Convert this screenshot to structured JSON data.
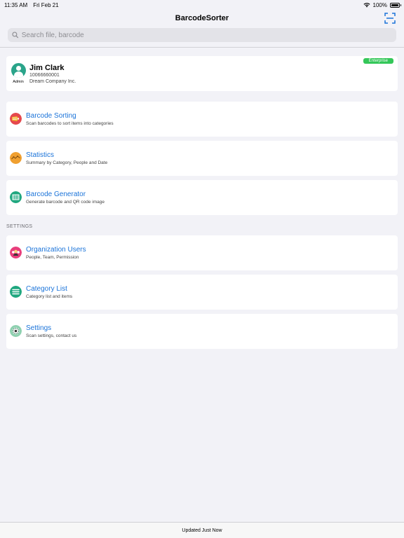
{
  "status_bar": {
    "time": "11:35 AM",
    "date": "Fri Feb 21",
    "battery": "100%"
  },
  "nav": {
    "title": "BarcodeSorter"
  },
  "search": {
    "placeholder": "Search file, barcode"
  },
  "profile": {
    "name": "Jim Clark",
    "id": "10066660001",
    "company": "Dream Company Inc.",
    "role": "Admin",
    "badge": "Enterprise"
  },
  "menu": [
    {
      "title": "Barcode Sorting",
      "subtitle": "Scan barcodes to sort items into categories"
    },
    {
      "title": "Statistics",
      "subtitle": "Summary by Category, People and Date"
    },
    {
      "title": "Barcode Generator",
      "subtitle": "Generate barcode and QR code image"
    }
  ],
  "settings_section": {
    "header": "SETTINGS",
    "items": [
      {
        "title": "Organization Users",
        "subtitle": "People, Team, Permission"
      },
      {
        "title": "Category List",
        "subtitle": "Category list and items"
      },
      {
        "title": "Settings",
        "subtitle": "Scan settings, contact us"
      }
    ]
  },
  "footer": {
    "status": "Updated Just Now"
  },
  "colors": {
    "accent": "#1a73d9",
    "badge": "#34c759",
    "avatar": "#2aa48a"
  }
}
